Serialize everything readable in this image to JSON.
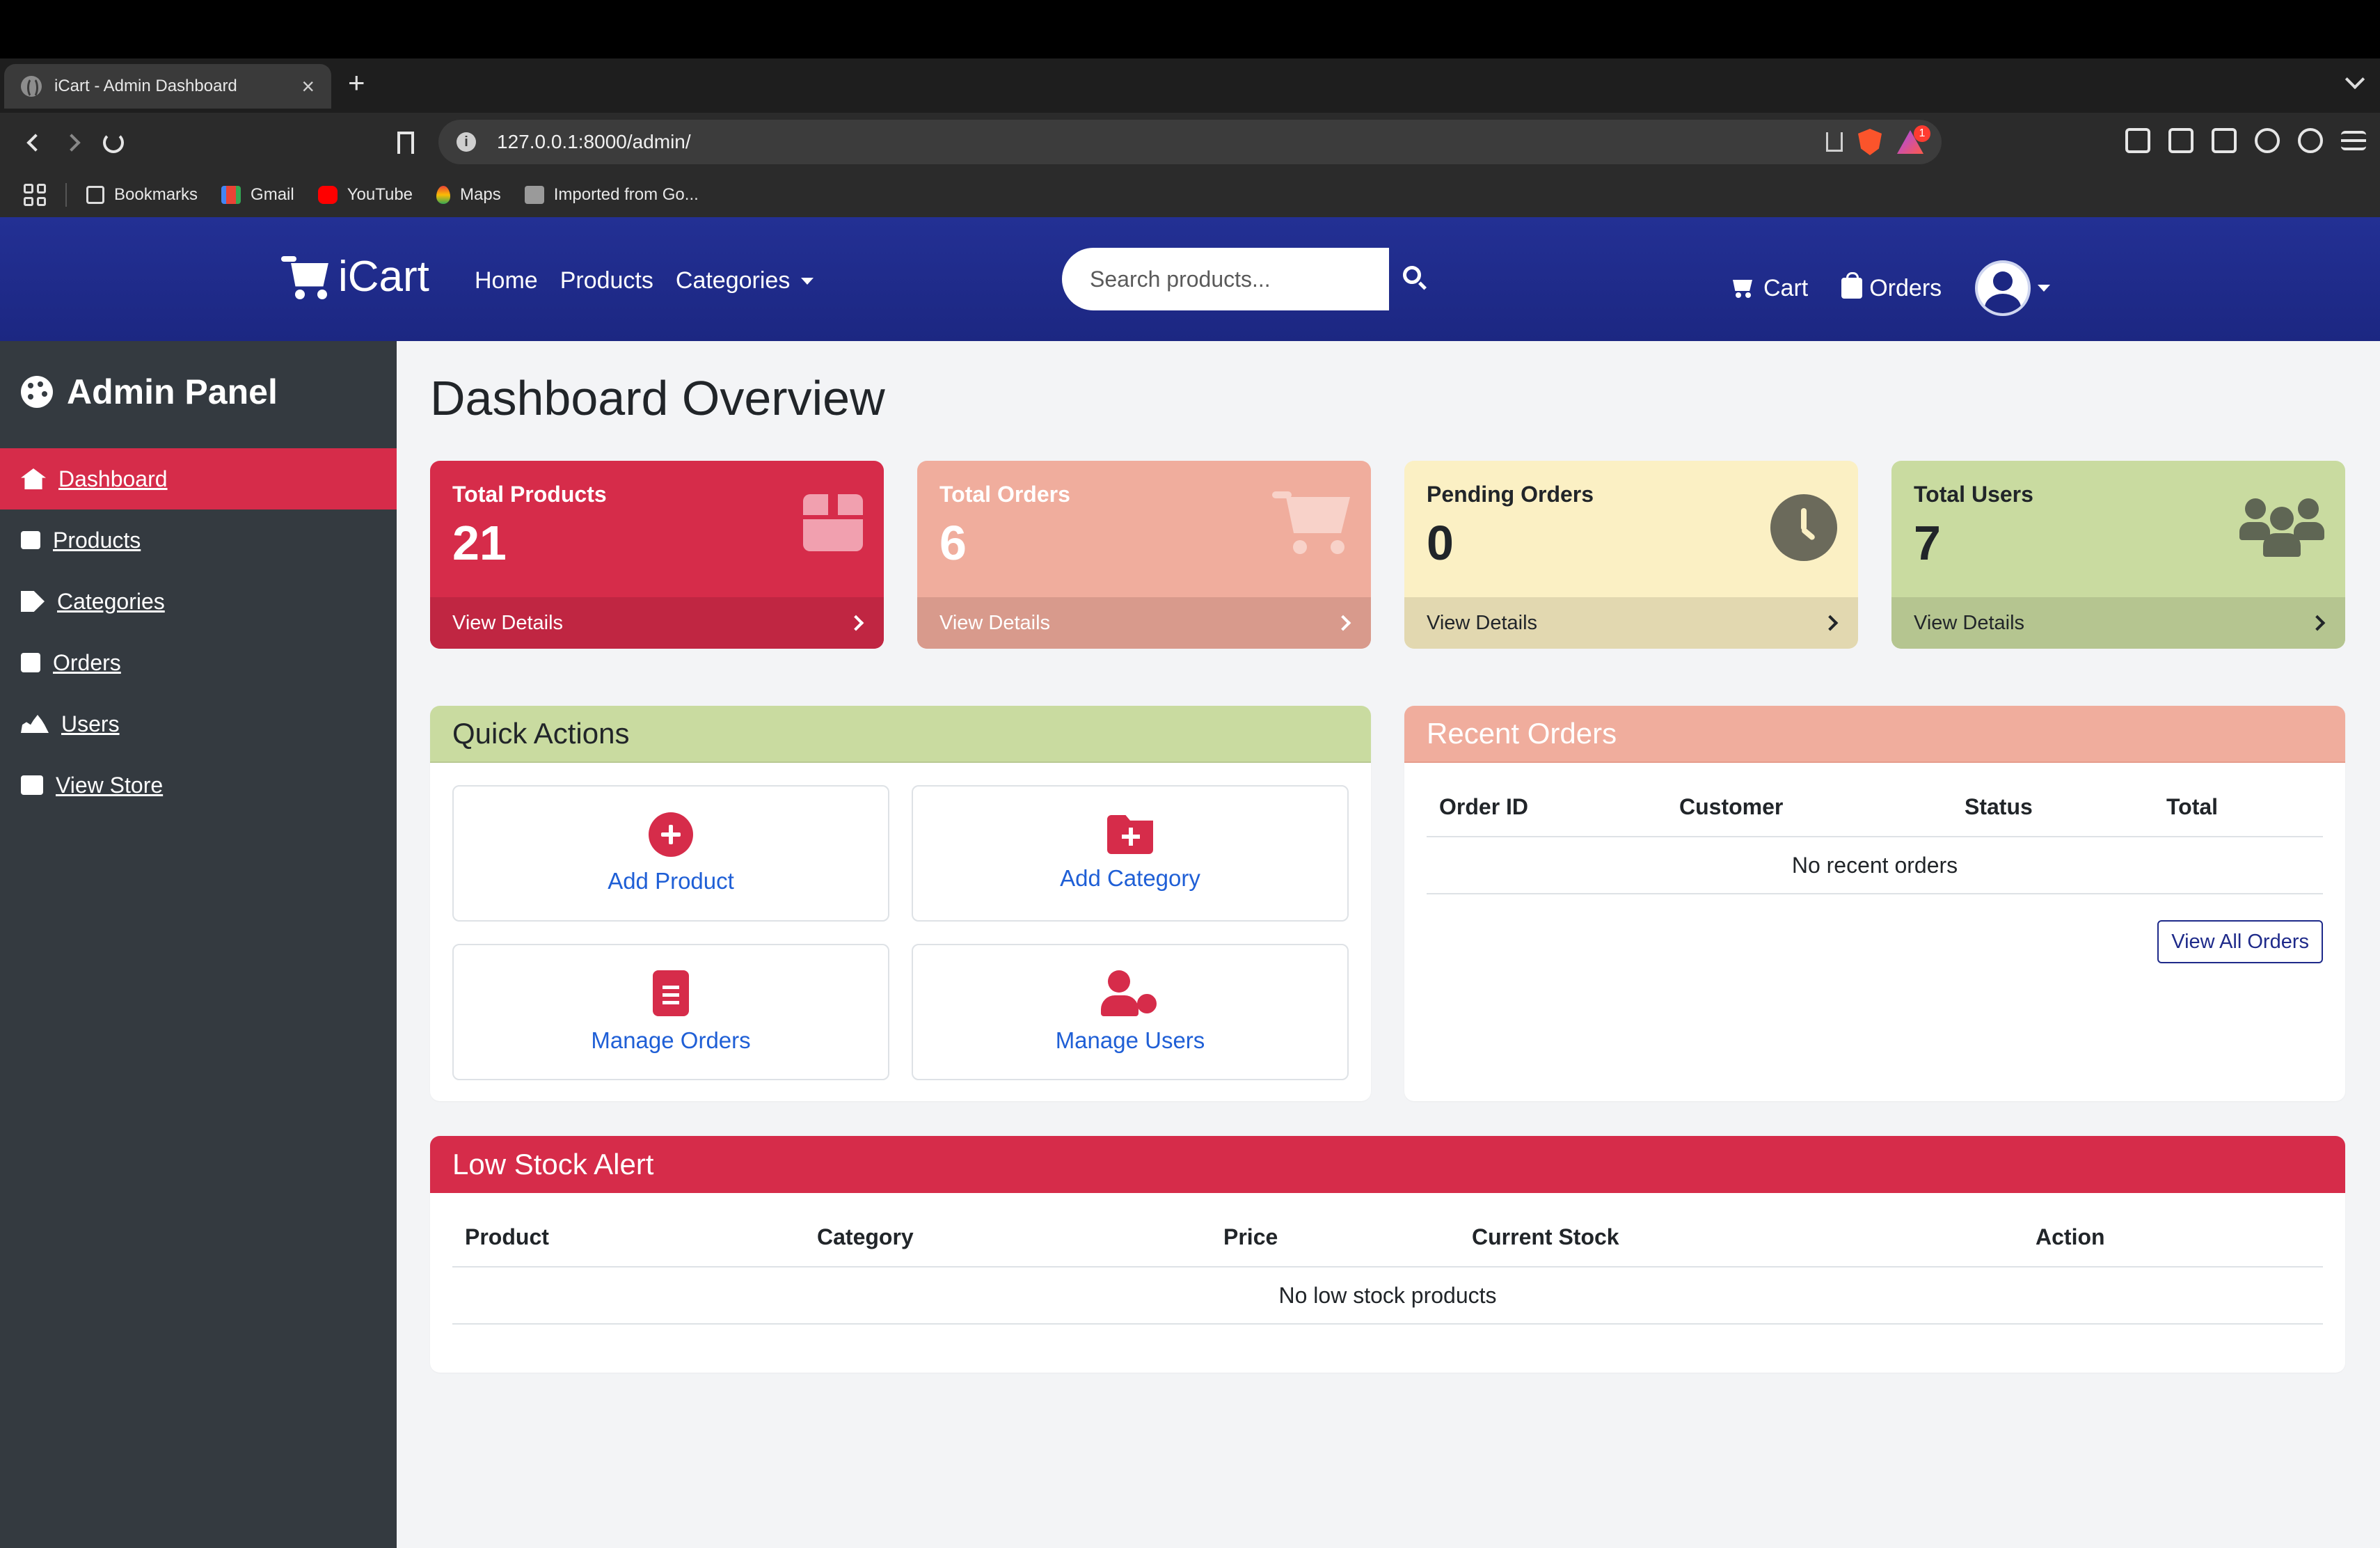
{
  "browser": {
    "tab_title": "iCart - Admin Dashboard",
    "url": "127.0.0.1:8000/admin/",
    "rewards_badge": "1",
    "bookmarks": [
      {
        "label": "Bookmarks",
        "icon": "bookmark-icon"
      },
      {
        "label": "Gmail",
        "icon": "gmail-icon"
      },
      {
        "label": "YouTube",
        "icon": "youtube-icon"
      },
      {
        "label": "Maps",
        "icon": "maps-icon"
      },
      {
        "label": "Imported from Go...",
        "icon": "folder-icon"
      }
    ]
  },
  "header": {
    "brand": "iCart",
    "nav": [
      "Home",
      "Products",
      "Categories"
    ],
    "search_placeholder": "Search products...",
    "cart_label": "Cart",
    "orders_label": "Orders"
  },
  "sidebar": {
    "title": "Admin Panel",
    "items": [
      {
        "label": "Dashboard",
        "icon": "home-icon",
        "active": true
      },
      {
        "label": "Products",
        "icon": "box-icon"
      },
      {
        "label": "Categories",
        "icon": "tags-icon"
      },
      {
        "label": "Orders",
        "icon": "shopping-bag-icon"
      },
      {
        "label": "Users",
        "icon": "users-icon"
      },
      {
        "label": "View Store",
        "icon": "store-icon"
      }
    ]
  },
  "main": {
    "title": "Dashboard Overview",
    "stats": [
      {
        "label": "Total Products",
        "value": "21",
        "link": "View Details",
        "icon": "box-icon",
        "color": "#d62c4a"
      },
      {
        "label": "Total Orders",
        "value": "6",
        "link": "View Details",
        "icon": "cart-icon",
        "color": "#f0ad9d"
      },
      {
        "label": "Pending Orders",
        "value": "0",
        "link": "View Details",
        "icon": "clock-icon",
        "color": "#fbf0c4"
      },
      {
        "label": "Total Users",
        "value": "7",
        "link": "View Details",
        "icon": "users-icon",
        "color": "#c9dba0"
      }
    ],
    "quick_actions": {
      "title": "Quick Actions",
      "buttons": [
        {
          "label": "Add Product",
          "icon": "plus-circle-icon"
        },
        {
          "label": "Add Category",
          "icon": "folder-plus-icon"
        },
        {
          "label": "Manage Orders",
          "icon": "clipboard-list-icon"
        },
        {
          "label": "Manage Users",
          "icon": "user-cog-icon"
        }
      ]
    },
    "recent_orders": {
      "title": "Recent Orders",
      "columns": [
        "Order ID",
        "Customer",
        "Status",
        "Total"
      ],
      "empty": "No recent orders",
      "view_all": "View All Orders"
    },
    "low_stock": {
      "title": "Low Stock Alert",
      "columns": [
        "Product",
        "Category",
        "Price",
        "Current Stock",
        "Action"
      ],
      "empty": "No low stock products"
    }
  }
}
